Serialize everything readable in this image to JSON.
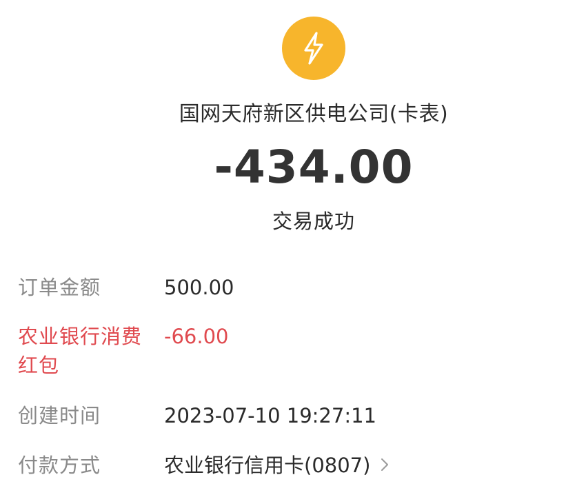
{
  "merchant": {
    "logo_icon": "lightning-bolt-icon",
    "logo_color": "#F7B52C",
    "name": "国网天府新区供电公司(卡表)"
  },
  "transaction": {
    "amount": "-434.00",
    "status": "交易成功"
  },
  "details": [
    {
      "label": "订单金额",
      "value": "500.00"
    },
    {
      "label": "农业银行消费红包",
      "value": "-66.00",
      "highlight_color": "#E04A4F"
    },
    {
      "label": "创建时间",
      "value": "2023-07-10 19:27:11"
    },
    {
      "label": "付款方式",
      "value": "农业银行信用卡(0807)",
      "icon": "chevron-right-icon"
    }
  ]
}
